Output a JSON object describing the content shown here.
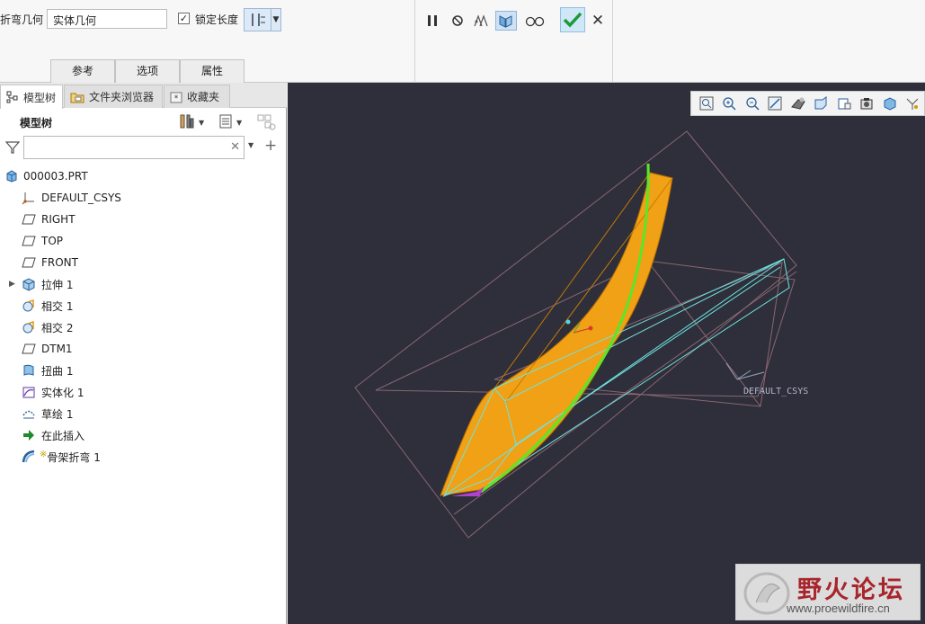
{
  "ribbon": {
    "bend_label": "折弯几何",
    "bend_value": "实体几何",
    "lock_checked": "✓",
    "lock_label": "锁定长度",
    "tabs": [
      {
        "label": "参考"
      },
      {
        "label": "选项"
      },
      {
        "label": "属性"
      }
    ],
    "colors": {
      "ok_accent": "#1a9a3a",
      "active_bg": "#cfe2f5"
    }
  },
  "sidebar": {
    "tabs": [
      {
        "label": "模型树",
        "icon": "model-tree-icon"
      },
      {
        "label": "文件夹浏览器",
        "icon": "folder-browser-icon"
      },
      {
        "label": "收藏夹",
        "icon": "favorites-icon"
      }
    ],
    "tree_title": "模型树",
    "search_placeholder": "",
    "tree": [
      {
        "label": "000003.PRT",
        "icon": "part-icon"
      },
      {
        "label": "DEFAULT_CSYS",
        "icon": "csys-icon"
      },
      {
        "label": "RIGHT",
        "icon": "datum-plane-icon"
      },
      {
        "label": "TOP",
        "icon": "datum-plane-icon"
      },
      {
        "label": "FRONT",
        "icon": "datum-plane-icon"
      },
      {
        "label": "拉伸 1",
        "icon": "extrude-icon"
      },
      {
        "label": "相交 1",
        "icon": "intersect-icon"
      },
      {
        "label": "相交 2",
        "icon": "intersect-icon"
      },
      {
        "label": "DTM1",
        "icon": "datum-plane-icon"
      },
      {
        "label": "扭曲 1",
        "icon": "warp-icon"
      },
      {
        "label": "实体化 1",
        "icon": "solidify-icon"
      },
      {
        "label": "草绘 1",
        "icon": "sketch-icon"
      },
      {
        "label": "在此插入",
        "icon": "insert-here-icon"
      },
      {
        "label": "骨架折弯 1",
        "icon": "spinal-bend-icon"
      }
    ]
  },
  "viewport": {
    "csys_label": "DEFAULT_CSYS",
    "background": "#2e2f3b",
    "model_color": "#f0a116",
    "trajectory_color": "#5be62a",
    "watermark_cn": "野火论坛",
    "watermark_url": "www.proewildfire.cn"
  }
}
